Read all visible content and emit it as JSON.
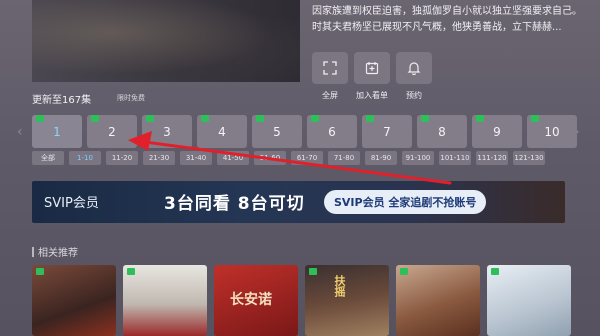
{
  "description": {
    "line1": "因家族遭到权臣迫害，独孤伽罗自小就以独立坚强要求自己。",
    "line2": "时其夫君杨坚已展现不凡气概，他狭勇善战，立下赫赫..."
  },
  "actions": [
    {
      "label": "全屏",
      "icon": "fullscreen-icon"
    },
    {
      "label": "加入看单",
      "icon": "add-watchlist-icon"
    },
    {
      "label": "预约",
      "icon": "bell-icon"
    }
  ],
  "update_text": "更新至167集",
  "free_text": "限时免费",
  "episodes": [
    "1",
    "2",
    "3",
    "4",
    "5",
    "6",
    "7",
    "8",
    "9",
    "10"
  ],
  "ranges": [
    "全部",
    "1-10",
    "11-20",
    "21-30",
    "31-40",
    "41-50",
    "51-60",
    "61-70",
    "71-80",
    "81-90",
    "91-100",
    "101-110",
    "111-120",
    "121-130"
  ],
  "banner": {
    "svip_label": "SVIP会员",
    "headline": "3台同看  8台可切",
    "pill": "SVIP会员 全家追剧不抢账号"
  },
  "section_title": "相关推荐",
  "posters": [
    {
      "title": ""
    },
    {
      "title": ""
    },
    {
      "title": "长安诺"
    },
    {
      "title": "扶摇"
    },
    {
      "title": ""
    },
    {
      "title": ""
    }
  ],
  "colors": {
    "accent": "#e0202a",
    "vip_badge": "#2fbf5a",
    "active_text": "#8fd4ff"
  }
}
